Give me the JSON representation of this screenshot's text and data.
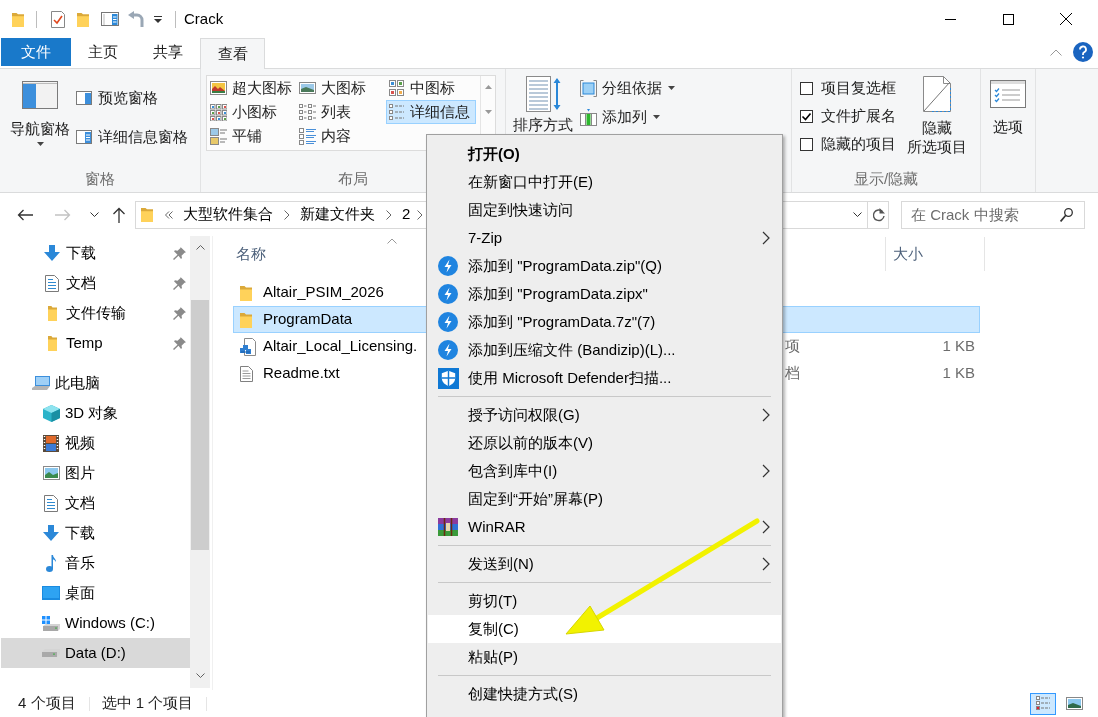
{
  "window": {
    "title": "Crack"
  },
  "ribbon_tabs": [
    {
      "label": "文件",
      "kind": "menu",
      "selected": false
    },
    {
      "label": "主页",
      "kind": "tab",
      "selected": false
    },
    {
      "label": "共享",
      "kind": "tab",
      "selected": false
    },
    {
      "label": "查看",
      "kind": "tab",
      "selected": true
    }
  ],
  "ribbon": {
    "panes": {
      "label": "窗格",
      "navigation_pane": "导航窗格",
      "preview_pane": "预览窗格",
      "details_pane": "详细信息窗格"
    },
    "layout": {
      "label": "布局",
      "items": [
        {
          "label": "超大图标",
          "kind": "extralarge",
          "selected": false
        },
        {
          "label": "大图标",
          "kind": "large",
          "selected": false
        },
        {
          "label": "中图标",
          "kind": "medium",
          "selected": false
        },
        {
          "label": "小图标",
          "kind": "small",
          "selected": false
        },
        {
          "label": "列表",
          "kind": "list",
          "selected": false
        },
        {
          "label": "详细信息",
          "kind": "details",
          "selected": true
        },
        {
          "label": "平铺",
          "kind": "tiles",
          "selected": false
        },
        {
          "label": "内容",
          "kind": "content",
          "selected": false
        }
      ]
    },
    "current_view": {
      "sort_by": "排序方式",
      "group_by": "分组依据",
      "add_columns": "添加列"
    },
    "show_hide": {
      "label": "显示/隐藏",
      "checkboxes": [
        {
          "label": "项目复选框",
          "checked": false
        },
        {
          "label": "文件扩展名",
          "checked": true
        },
        {
          "label": "隐藏的项目",
          "checked": false
        }
      ],
      "hide_selected": [
        "隐藏",
        "所选项目"
      ]
    },
    "options": "选项"
  },
  "address_bar": {
    "crumbs": [
      "大型软件集合",
      "新建文件夹",
      "2"
    ]
  },
  "search": {
    "placeholder": "在 Crack 中搜索"
  },
  "navigation": {
    "quick_access": [
      {
        "label": "下载",
        "kind": "downloads",
        "pinned": true,
        "selected": false
      },
      {
        "label": "文档",
        "kind": "documents",
        "pinned": true,
        "selected": false
      },
      {
        "label": "文件传输",
        "kind": "folder",
        "pinned": true,
        "selected": false
      },
      {
        "label": "Temp",
        "kind": "folder",
        "pinned": true,
        "selected": false
      }
    ],
    "tree": [
      {
        "label": "此电脑",
        "kind": "computer",
        "selected": false,
        "children": [
          {
            "label": "3D 对象",
            "kind": "objects",
            "selected": false
          },
          {
            "label": "视频",
            "kind": "videos",
            "selected": false
          },
          {
            "label": "图片",
            "kind": "pictures",
            "selected": false
          },
          {
            "label": "文档",
            "kind": "documents",
            "selected": false
          },
          {
            "label": "下载",
            "kind": "downloads",
            "selected": false
          },
          {
            "label": "音乐",
            "kind": "music",
            "selected": false
          },
          {
            "label": "桌面",
            "kind": "desktop",
            "selected": false
          },
          {
            "label": "Windows (C:)",
            "kind": "system",
            "selected": false
          },
          {
            "label": "Data (D:)",
            "kind": "drive",
            "selected": true
          }
        ]
      }
    ]
  },
  "file_list": {
    "columns": [
      {
        "label": "名称",
        "sorted": true
      },
      {
        "label": "大小",
        "sorted": false
      }
    ],
    "rows": [
      {
        "name": "Altair_PSIM_2026",
        "kind": "folder",
        "selected": false
      },
      {
        "name": "ProgramData",
        "kind": "folder",
        "selected": true
      },
      {
        "name": "Altair_Local_Licensing.",
        "kind": "installer",
        "selected": false,
        "column_3": "项",
        "size": "1 KB"
      },
      {
        "name": "Readme.txt",
        "kind": "text",
        "selected": false,
        "column_3": "档",
        "size": "1 KB"
      }
    ]
  },
  "status_bar": {
    "item_count": "4 个项目",
    "selection": "选中 1 个项目"
  },
  "view_buttons": [
    {
      "kind": "details",
      "selected": true
    },
    {
      "kind": "thumbnails",
      "selected": false
    }
  ],
  "context_menu": {
    "items": [
      {
        "kind": "command",
        "label": "打开(O)",
        "default": true,
        "submenu": false,
        "selected": false
      },
      {
        "kind": "command",
        "label": "在新窗口中打开(E)",
        "default": false,
        "submenu": false,
        "selected": false
      },
      {
        "kind": "command",
        "label": "固定到快速访问",
        "default": false,
        "submenu": false,
        "selected": false
      },
      {
        "kind": "command",
        "label": "7-Zip",
        "default": false,
        "submenu": true,
        "selected": false
      },
      {
        "kind": "compress",
        "label": "添加到 \"ProgramData.zip\"(Q)",
        "default": false,
        "submenu": false,
        "selected": false
      },
      {
        "kind": "compress",
        "label": "添加到 \"ProgramData.zipx\"",
        "default": false,
        "submenu": false,
        "selected": false
      },
      {
        "kind": "compress",
        "label": "添加到 \"ProgramData.7z\"(7)",
        "default": false,
        "submenu": false,
        "selected": false
      },
      {
        "kind": "compress",
        "label": "添加到压缩文件 (Bandizip)(L)...",
        "default": false,
        "submenu": false,
        "selected": false
      },
      {
        "kind": "scan",
        "label": "使用 Microsoft Defender扫描...",
        "default": false,
        "submenu": false,
        "selected": false
      },
      {
        "kind": "separator"
      },
      {
        "kind": "command",
        "label": "授予访问权限(G)",
        "default": false,
        "submenu": true,
        "selected": false
      },
      {
        "kind": "command",
        "label": "还原以前的版本(V)",
        "default": false,
        "submenu": false,
        "selected": false
      },
      {
        "kind": "command",
        "label": "包含到库中(I)",
        "default": false,
        "submenu": true,
        "selected": false
      },
      {
        "kind": "command",
        "label": "固定到“开始”屏幕(P)",
        "default": false,
        "submenu": false,
        "selected": false
      },
      {
        "kind": "archiver",
        "label": "WinRAR",
        "default": false,
        "submenu": true,
        "selected": false
      },
      {
        "kind": "separator"
      },
      {
        "kind": "command",
        "label": "发送到(N)",
        "default": false,
        "submenu": true,
        "selected": false
      },
      {
        "kind": "separator"
      },
      {
        "kind": "command",
        "label": "剪切(T)",
        "default": false,
        "submenu": false,
        "selected": false
      },
      {
        "kind": "command",
        "label": "复制(C)",
        "default": false,
        "submenu": false,
        "selected": true
      },
      {
        "kind": "command",
        "label": "粘贴(P)",
        "default": false,
        "submenu": false,
        "selected": false
      },
      {
        "kind": "separator"
      },
      {
        "kind": "command",
        "label": "创建快捷方式(S)",
        "default": false,
        "submenu": false,
        "selected": false
      }
    ]
  }
}
